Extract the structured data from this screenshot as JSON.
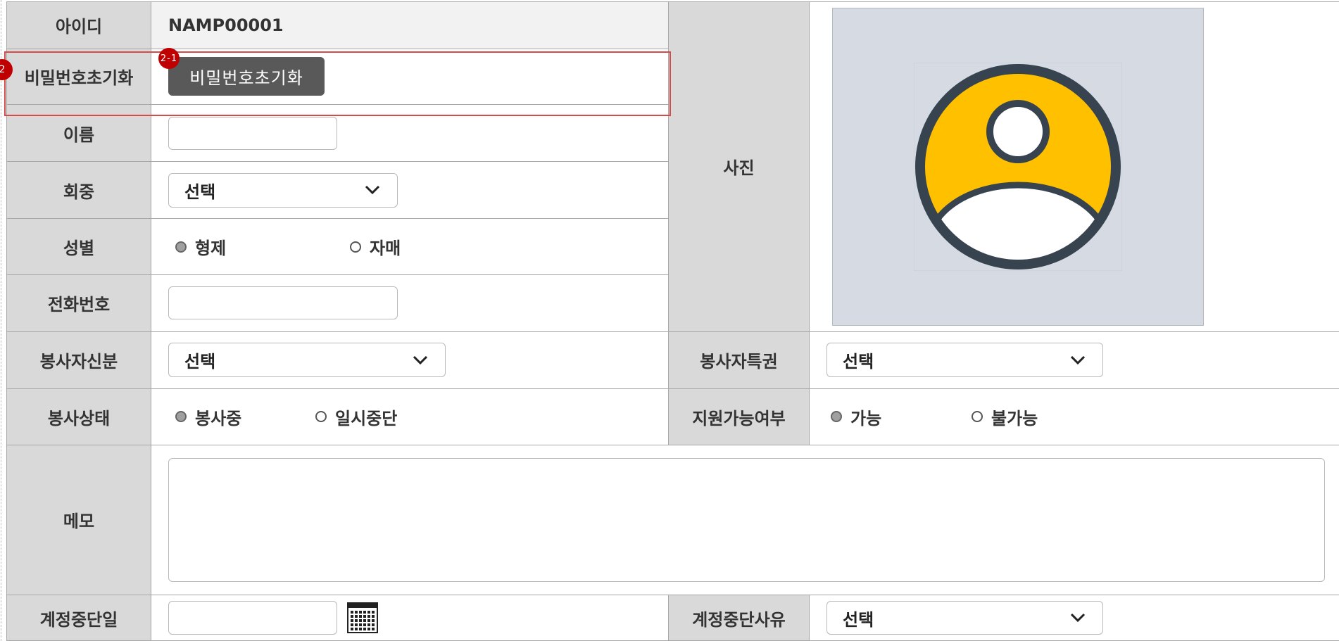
{
  "fields": {
    "id": {
      "label": "아이디",
      "value": "NAMP00001"
    },
    "password_reset": {
      "label": "비밀번호초기화",
      "button_label": "비밀번호초기화"
    },
    "name": {
      "label": "이름",
      "value": ""
    },
    "congregation": {
      "label": "회중",
      "selected": "선택"
    },
    "gender": {
      "label": "성별",
      "options": [
        "형제",
        "자매"
      ],
      "checked_index": 0
    },
    "phone": {
      "label": "전화번호",
      "value": ""
    },
    "photo": {
      "label": "사진"
    },
    "volunteer_status_role": {
      "label": "봉사자신분",
      "selected": "선택"
    },
    "volunteer_privilege": {
      "label": "봉사자특권",
      "selected": "선택"
    },
    "service_state": {
      "label": "봉사상태",
      "options": [
        "봉사중",
        "일시중단"
      ],
      "checked_index": 0
    },
    "availability": {
      "label": "지원가능여부",
      "options": [
        "가능",
        "불가능"
      ],
      "checked_index": 0
    },
    "memo": {
      "label": "메모",
      "value": ""
    },
    "suspend_date": {
      "label": "계정중단일",
      "value": ""
    },
    "suspend_reason": {
      "label": "계정중단사유",
      "selected": "선택"
    }
  },
  "annotations": {
    "row_badge": "2",
    "button_badge": "2-1"
  },
  "colors": {
    "header_bg": "#d9d9d9",
    "button_bg": "#595959",
    "badge_red": "#c00000",
    "avatar_yellow": "#ffc000",
    "avatar_dark": "#37434f",
    "photo_bg": "#d5dae3"
  },
  "icons": {
    "avatar": "user-avatar-icon",
    "calendar": "calendar-icon",
    "chevron": "chevron-down-icon"
  }
}
